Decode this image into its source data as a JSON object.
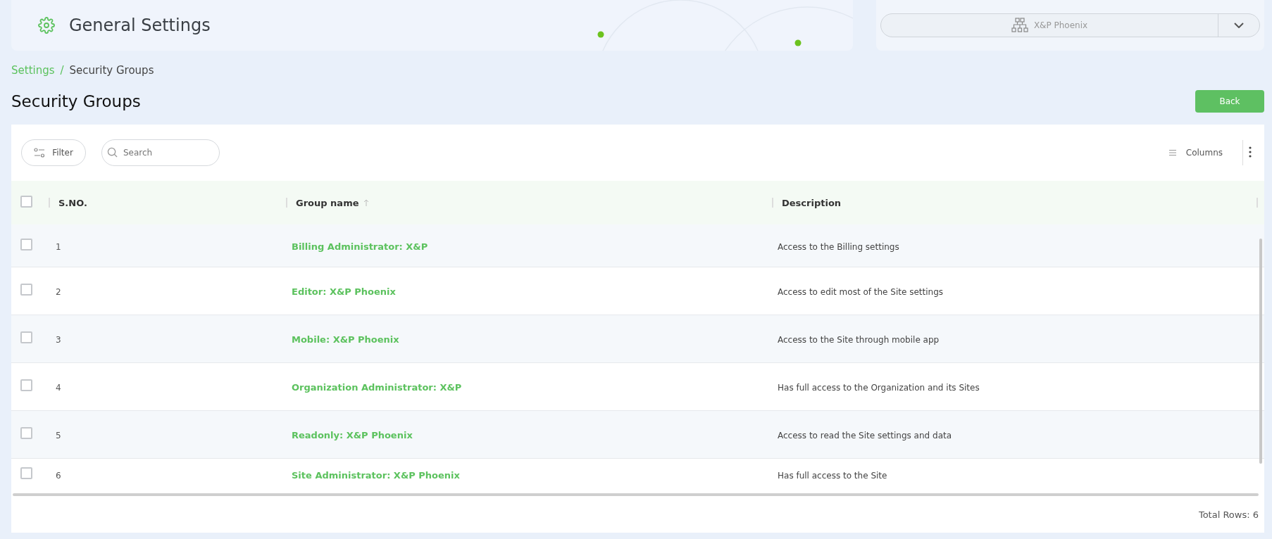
{
  "header": {
    "title": "General Settings"
  },
  "organization_selector": {
    "value": "X&P Phoenix"
  },
  "breadcrumb": [
    {
      "label": "Settings",
      "kind": "link"
    },
    {
      "label": "/",
      "kind": "separator"
    },
    {
      "label": "Security Groups",
      "kind": "current"
    }
  ],
  "page_title": "Security Groups",
  "back_button": "Back",
  "toolbar": {
    "filter": "Filter",
    "search": {
      "placeholder": "Search"
    },
    "columns": "Columns"
  },
  "table": {
    "select_all_checked": false,
    "columns": [
      {
        "label": "S.NO.",
        "sorted": false
      },
      {
        "label": "Group name",
        "sorted": true
      },
      {
        "label": "Description",
        "sorted": false
      }
    ],
    "rows": [
      {
        "checked": false,
        "sno": "1",
        "group_name": "Billing Administrator: X&P",
        "description": "Access to the Billing settings"
      },
      {
        "checked": false,
        "sno": "2",
        "group_name": "Editor: X&P Phoenix",
        "description": "Access to edit most of the Site settings"
      },
      {
        "checked": false,
        "sno": "3",
        "group_name": "Mobile: X&P Phoenix",
        "description": "Access to the Site through mobile app"
      },
      {
        "checked": false,
        "sno": "4",
        "group_name": "Organization Administrator: X&P",
        "description": "Has full access to the Organization and its Sites"
      },
      {
        "checked": false,
        "sno": "5",
        "group_name": "Readonly: X&P Phoenix",
        "description": "Access to read the Site settings and data"
      },
      {
        "checked": false,
        "sno": "6",
        "group_name": "Site Administrator: X&P Phoenix",
        "description": "Has full access to the Site"
      }
    ]
  },
  "footer": {
    "total_rows": "Total Rows: 6"
  }
}
